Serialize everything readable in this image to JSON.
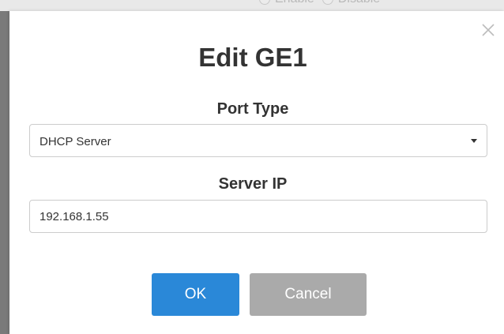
{
  "background": {
    "radio_options": [
      "Enable",
      "Disable"
    ]
  },
  "dialog": {
    "title": "Edit GE1",
    "close_icon": "close-icon",
    "port_type_label": "Port Type",
    "port_type_value": "DHCP Server",
    "server_ip_label": "Server IP",
    "server_ip_value": "192.168.1.55",
    "ok_label": "OK",
    "cancel_label": "Cancel"
  },
  "colors": {
    "primary": "#2a88d8",
    "secondary": "#aaaaaa",
    "text": "#333333",
    "border": "#cccccc"
  }
}
